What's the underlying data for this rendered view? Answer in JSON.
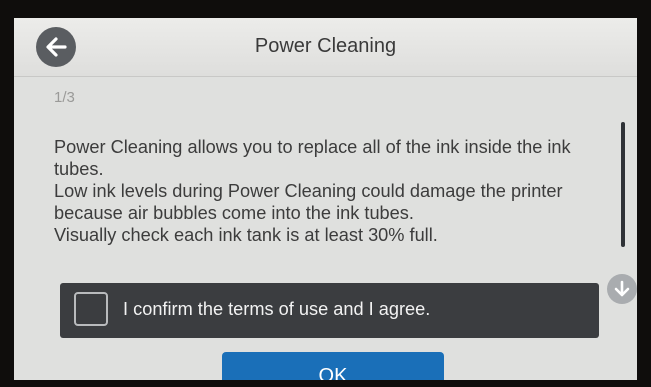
{
  "header": {
    "title": "Power Cleaning",
    "back_icon": "arrow-left-icon"
  },
  "main": {
    "page_counter": "1/3",
    "message_lines": [
      "Power Cleaning allows you to replace all of the ink inside the ink tubes.",
      "Low ink levels during Power Cleaning could damage the printer because air bubbles come into the ink tubes.",
      "Visually check each ink tank is at least 30% full."
    ],
    "scroll_down_icon": "arrow-down-icon"
  },
  "confirm": {
    "label": "I confirm the terms of use and I agree.",
    "checked": false
  },
  "footer": {
    "ok_label": "OK"
  },
  "colors": {
    "header_bg": "#e9e9e7",
    "confirm_bg": "#3b3d40",
    "ok_bg": "#1a6fb8"
  }
}
